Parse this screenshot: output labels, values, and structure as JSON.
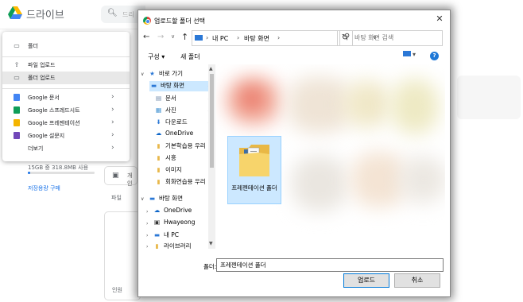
{
  "drive": {
    "title": "드라이브",
    "search_placeholder": "드리",
    "storage_text": "15GB 중 318.8MB 사용",
    "storage_used_fraction": 0.021,
    "storage_buy": "저장용량 구매",
    "bg_row_label": "개인",
    "bg_files_label": "파일",
    "bg_card_label": "인원"
  },
  "new_menu": {
    "items": [
      {
        "label": "폴더",
        "icon": "new-folder-icon"
      },
      {
        "label": "파일 업로드",
        "icon": "file-upload-icon"
      },
      {
        "label": "폴더 업로드",
        "icon": "folder-upload-icon",
        "highlighted": true
      },
      {
        "label": "Google 문서",
        "icon": "docs-icon",
        "color": "#4285f4"
      },
      {
        "label": "Google 스프레드시트",
        "icon": "sheets-icon",
        "color": "#0f9d58"
      },
      {
        "label": "Google 프레젠테이션",
        "icon": "slides-icon",
        "color": "#f4b400"
      },
      {
        "label": "Google 설문지",
        "icon": "forms-icon",
        "color": "#7248b9"
      },
      {
        "label": "더보기",
        "icon": "more-icon"
      }
    ]
  },
  "dialog": {
    "title": "업로드할 폴더 선택",
    "breadcrumb": [
      "내 PC",
      "바탕 화면"
    ],
    "search_placeholder": "바탕 화면 검색",
    "organize": "구성 ▾",
    "new_folder": "새 폴더",
    "nav_items": [
      {
        "label": "바로 가기",
        "icon": "star-icon"
      },
      {
        "label": "바탕 화면",
        "icon": "desktop-icon",
        "selected": true
      },
      {
        "label": "문서",
        "icon": "documents-icon"
      },
      {
        "label": "사진",
        "icon": "pictures-icon"
      },
      {
        "label": "다운로드",
        "icon": "download-icon"
      },
      {
        "label": "OneDrive",
        "icon": "onedrive-icon"
      },
      {
        "label": "기본학습용 우리",
        "icon": "folder-icon"
      },
      {
        "label": "시흥",
        "icon": "folder-icon"
      },
      {
        "label": "이미지",
        "icon": "folder-icon"
      },
      {
        "label": "회화연습용 우리",
        "icon": "folder-icon"
      },
      {
        "label": "바탕 화면",
        "icon": "desktop-icon"
      },
      {
        "label": "OneDrive",
        "icon": "onedrive-icon"
      },
      {
        "label": "Hwayeong",
        "icon": "user-icon"
      },
      {
        "label": "내 PC",
        "icon": "pc-icon"
      },
      {
        "label": "라이브러리",
        "icon": "library-icon"
      }
    ],
    "selected_folder": "프레젠테이션 폴더",
    "folder_field_label": "폴더:",
    "folder_field_value": "프레젠테이션 폴더",
    "upload_button": "업로드",
    "cancel_button": "취소"
  }
}
